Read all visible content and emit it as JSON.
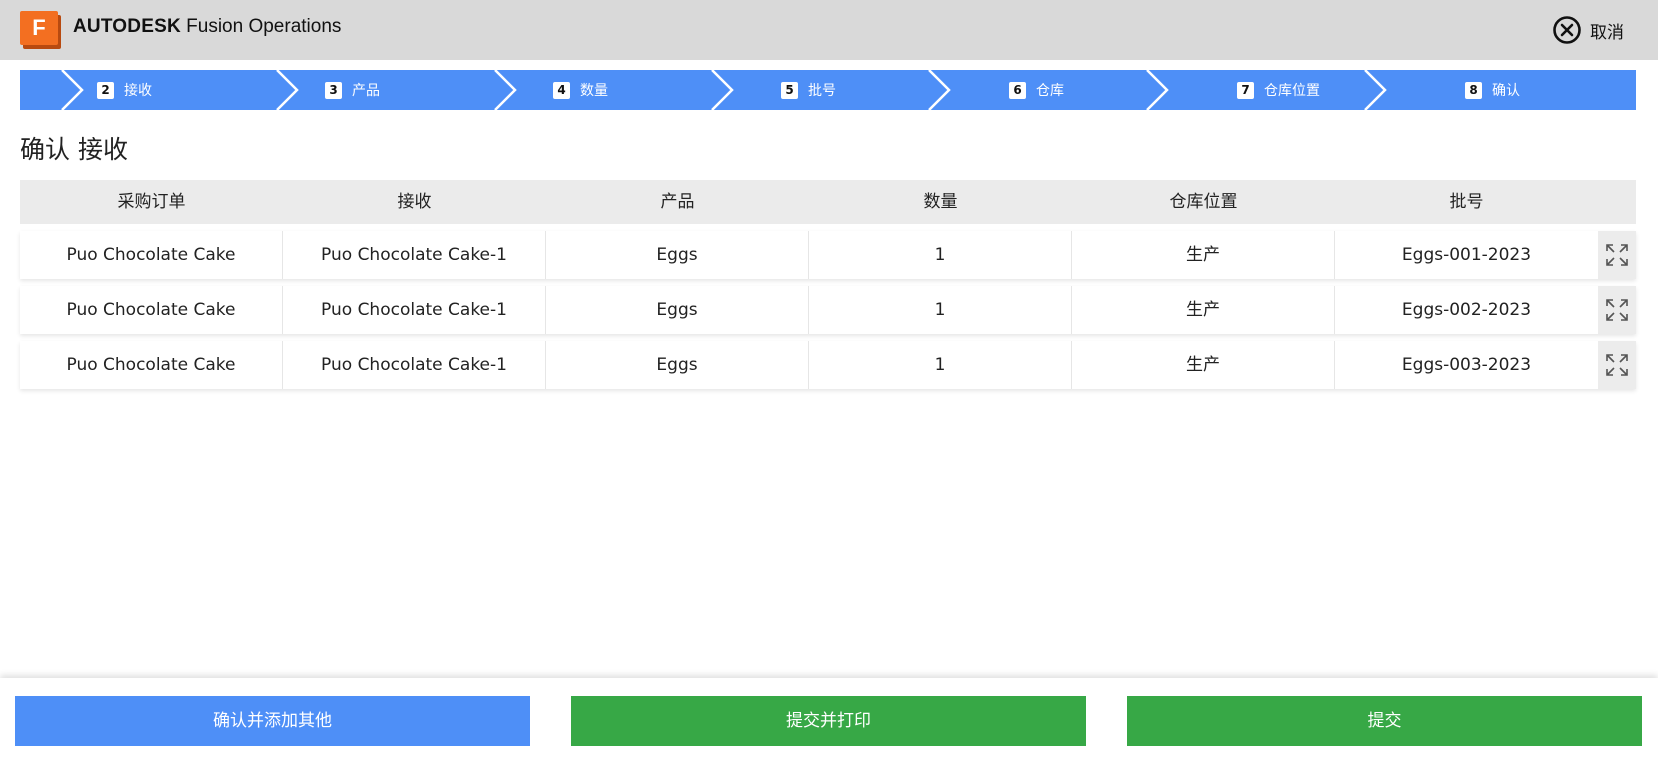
{
  "app": {
    "brand_strong": "AUTODESK",
    "brand_rest": " Fusion Operations",
    "logo_letter": "F",
    "cancel_label": "取消"
  },
  "stepper": {
    "steps": [
      {
        "num": "2",
        "label": "接收"
      },
      {
        "num": "3",
        "label": "产品"
      },
      {
        "num": "4",
        "label": "数量"
      },
      {
        "num": "5",
        "label": "批号"
      },
      {
        "num": "6",
        "label": "仓库"
      },
      {
        "num": "7",
        "label": "仓库位置"
      },
      {
        "num": "8",
        "label": "确认"
      }
    ]
  },
  "page": {
    "title": "确认 接收"
  },
  "table": {
    "headers": [
      "采购订单",
      "接收",
      "产品",
      "数量",
      "仓库位置",
      "批号"
    ],
    "rows": [
      [
        "Puo Chocolate Cake",
        "Puo Chocolate Cake-1",
        "Eggs",
        "1",
        "生产",
        "Eggs-001-2023"
      ],
      [
        "Puo Chocolate Cake",
        "Puo Chocolate Cake-1",
        "Eggs",
        "1",
        "生产",
        "Eggs-002-2023"
      ],
      [
        "Puo Chocolate Cake",
        "Puo Chocolate Cake-1",
        "Eggs",
        "1",
        "生产",
        "Eggs-003-2023"
      ]
    ]
  },
  "footer": {
    "confirm_add_label": "确认并添加其他",
    "submit_print_label": "提交并打印",
    "submit_label": "提交"
  },
  "colors": {
    "accent_blue": "#4e8ff7",
    "action_green": "#37a846",
    "brand_orange": "#f36f21"
  },
  "icons": [
    "close-circle-icon",
    "expand-icon"
  ]
}
